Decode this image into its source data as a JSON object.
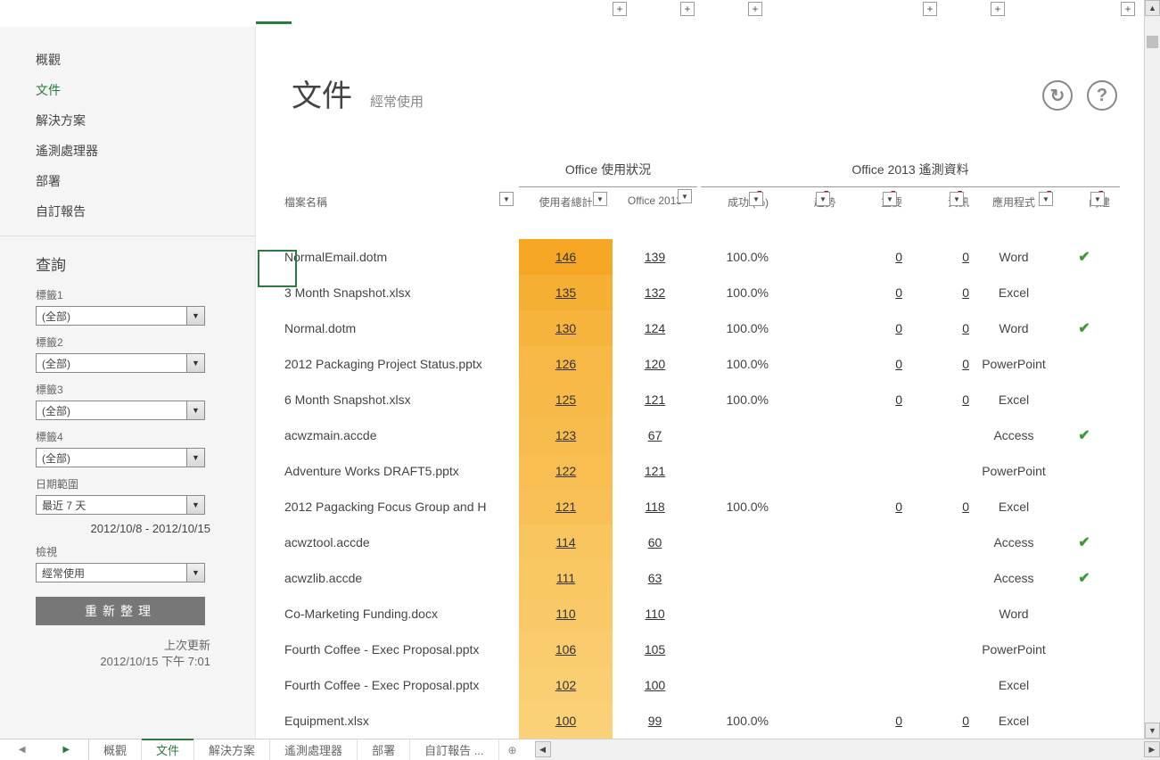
{
  "nav": {
    "items": [
      "概觀",
      "文件",
      "解決方案",
      "遙測處理器",
      "部署",
      "自訂報告"
    ],
    "active_index": 1
  },
  "query": {
    "title": "查詢",
    "labels": [
      "標籤1",
      "標籤2",
      "標籤3",
      "標籤4"
    ],
    "select_value": "(全部)",
    "date_label": "日期範圍",
    "date_value": "最近 7 天",
    "date_range_display": "2012/10/8 - 2012/10/15",
    "view_label": "檢視",
    "view_value": "經常使用",
    "refresh": "重新整理",
    "last_update_label": "上次更新",
    "last_update_value": "2012/10/15 下午 7:01"
  },
  "header": {
    "title": "文件",
    "subtitle": "經常使用"
  },
  "columns": {
    "group_usage": "Office 使用狀況",
    "group_telemetry": "Office 2013 遙測資料",
    "filename": "檔案名稱",
    "total_users": "使用者總計",
    "office2013": "Office 2013",
    "success": "成功 (%)",
    "trend": "趨勢",
    "critical": "重要",
    "info": "資訊",
    "app": "應用程式",
    "builtin": "內建"
  },
  "rows": [
    {
      "filename": "NormalEmail.dotm",
      "total": "146",
      "o2013": "139",
      "success": "100.0%",
      "critical": "0",
      "info": "0",
      "app": "Word",
      "builtin": true,
      "bg": "#f5a623"
    },
    {
      "filename": "3 Month Snapshot.xlsx",
      "total": "135",
      "o2013": "132",
      "success": "100.0%",
      "critical": "0",
      "info": "0",
      "app": "Excel",
      "builtin": false,
      "bg": "#f5af33"
    },
    {
      "filename": "Normal.dotm",
      "total": "130",
      "o2013": "124",
      "success": "100.0%",
      "critical": "0",
      "info": "0",
      "app": "Word",
      "builtin": true,
      "bg": "#f6b43d"
    },
    {
      "filename": "2012 Packaging Project Status.pptx",
      "total": "126",
      "o2013": "120",
      "success": "100.0%",
      "critical": "0",
      "info": "0",
      "app": "PowerPoint",
      "builtin": false,
      "bg": "#f7b845"
    },
    {
      "filename": "6 Month Snapshot.xlsx",
      "total": "125",
      "o2013": "121",
      "success": "100.0%",
      "critical": "0",
      "info": "0",
      "app": "Excel",
      "builtin": false,
      "bg": "#f7ba49"
    },
    {
      "filename": "acwzmain.accde",
      "total": "123",
      "o2013": "67",
      "success": "",
      "critical": "",
      "info": "",
      "app": "Access",
      "builtin": true,
      "bg": "#f7bc4e"
    },
    {
      "filename": "Adventure Works DRAFT5.pptx",
      "total": "122",
      "o2013": "121",
      "success": "",
      "critical": "",
      "info": "",
      "app": "PowerPoint",
      "builtin": false,
      "bg": "#f8be52"
    },
    {
      "filename": "2012 Pagacking Focus Group and H",
      "total": "121",
      "o2013": "118",
      "success": "100.0%",
      "critical": "0",
      "info": "0",
      "app": "Excel",
      "builtin": false,
      "bg": "#f8c057"
    },
    {
      "filename": "acwztool.accde",
      "total": "114",
      "o2013": "60",
      "success": "",
      "critical": "",
      "info": "",
      "app": "Access",
      "builtin": true,
      "bg": "#f9c55f"
    },
    {
      "filename": "acwzlib.accde",
      "total": "111",
      "o2013": "63",
      "success": "",
      "critical": "",
      "info": "",
      "app": "Access",
      "builtin": true,
      "bg": "#f9c863"
    },
    {
      "filename": "Co-Marketing Funding.docx",
      "total": "110",
      "o2013": "110",
      "success": "",
      "critical": "",
      "info": "",
      "app": "Word",
      "builtin": false,
      "bg": "#f9c967"
    },
    {
      "filename": "Fourth Coffee - Exec Proposal.pptx",
      "total": "106",
      "o2013": "105",
      "success": "",
      "critical": "",
      "info": "",
      "app": "PowerPoint",
      "builtin": false,
      "bg": "#facc6d"
    },
    {
      "filename": "Fourth Coffee - Exec Proposal.pptx",
      "total": "102",
      "o2013": "100",
      "success": "",
      "critical": "",
      "info": "",
      "app": "Excel",
      "builtin": false,
      "bg": "#facf73"
    },
    {
      "filename": "Equipment.xlsx",
      "total": "100",
      "o2013": "99",
      "success": "100.0%",
      "critical": "0",
      "info": "0",
      "app": "Excel",
      "builtin": false,
      "bg": "#fbd178"
    }
  ],
  "tabs": {
    "items": [
      "概觀",
      "文件",
      "解決方案",
      "遙測處理器",
      "部署",
      "自訂報告 ..."
    ],
    "active_index": 1
  }
}
